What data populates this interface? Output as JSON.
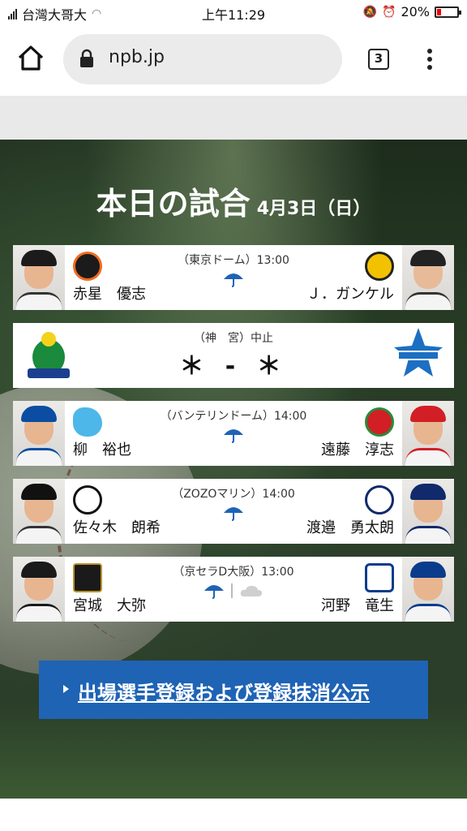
{
  "status": {
    "carrier": "台灣大哥大",
    "time": "上午11:29",
    "battery": "20%",
    "battery_level": 0.2
  },
  "browser": {
    "url": "npb.jp",
    "tab_count": "3"
  },
  "section": {
    "title": "本日の試合",
    "date": "4月3日（日）"
  },
  "games": [
    {
      "venue": "（東京ドーム）13:00",
      "home_pitcher": "赤星　優志",
      "away_pitcher": "Ｊ．ガンケル",
      "weather": [
        "rain"
      ]
    },
    {
      "venue": "（神　宮）中止",
      "score": "＊ - ＊"
    },
    {
      "venue": "（バンテリンドーム）14:00",
      "home_pitcher": "柳　裕也",
      "away_pitcher": "遠藤　淳志",
      "weather": [
        "rain"
      ]
    },
    {
      "venue": "（ZOZOマリン）14:00",
      "home_pitcher": "佐々木　朗希",
      "away_pitcher": "渡邉　勇太朗",
      "weather": [
        "rain"
      ]
    },
    {
      "venue": "（京セラD大阪）13:00",
      "home_pitcher": "宮城　大弥",
      "away_pitcher": "河野　竜生",
      "weather": [
        "rain",
        "cloud"
      ]
    }
  ],
  "register_link": "出場選手登録および登録抹消公示",
  "colors": {
    "link_button": "#1f63b5",
    "giants": "#f26b1f",
    "tigers": "#f2c200",
    "swallows": "#1a8a3c",
    "baystars": "#1c6fc2",
    "dragons": "#0b4da2",
    "carp": "#d11f25",
    "marines": "#111111",
    "lions": "#102a6b",
    "buffaloes": "#1a1a1a",
    "fighters": "#0b3c8c"
  }
}
